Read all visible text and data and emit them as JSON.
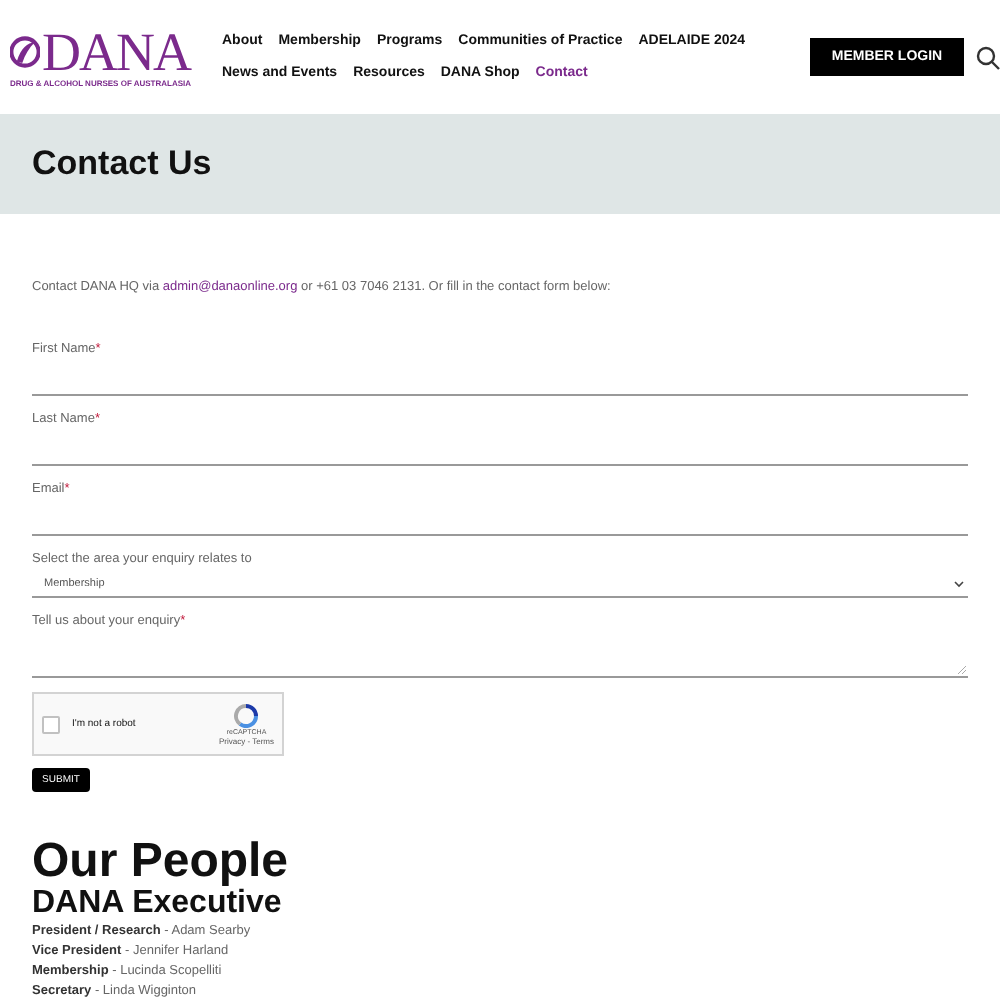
{
  "logo": {
    "name": "DANA",
    "tagline": "DRUG & ALCOHOL NURSES OF AUSTRALASIA"
  },
  "nav": [
    [
      {
        "label": "About",
        "selected": false
      },
      {
        "label": "Membership",
        "selected": false
      },
      {
        "label": "Programs",
        "selected": false
      },
      {
        "label": "Communities of Practice",
        "selected": false
      },
      {
        "label": "ADELAIDE 2024",
        "selected": false
      }
    ],
    [
      {
        "label": "News and Events",
        "selected": false
      },
      {
        "label": "Resources",
        "selected": false
      },
      {
        "label": "DANA Shop",
        "selected": false
      },
      {
        "label": "Contact",
        "selected": true
      }
    ]
  ],
  "login_button": "MEMBER LOGIN",
  "page_title": "Contact Us",
  "intro": {
    "before": "Contact DANA HQ via ",
    "link": "admin@danaonline.org",
    "after": " or +61 03 7046 2131. Or fill in the contact form below:"
  },
  "fields": [
    {
      "kind": "text",
      "label": "First Name",
      "asterisk": "*"
    },
    {
      "kind": "text",
      "label": "Last Name",
      "asterisk": "*"
    },
    {
      "kind": "text",
      "label": "Email",
      "asterisk": "*"
    },
    {
      "kind": "select",
      "label": "Select the area your enquiry relates to",
      "value": "Membership"
    },
    {
      "kind": "textarea",
      "label": "Tell us about your enquiry",
      "asterisk": "*"
    }
  ],
  "captcha": {
    "label": "I'm not a robot",
    "checked": false,
    "brand": "reCAPTCHA",
    "links": "Privacy - Terms"
  },
  "submit": "SUBMIT",
  "people": {
    "title": "Our People",
    "subtitle": "DANA Executive",
    "rows": [
      "**President / Research** - Adam Searby",
      "**Vice President** - Jennifer Harland",
      "**Membership** - Lucinda Scopelliti",
      "**Secretary** - Linda Wigginton"
    ]
  }
}
